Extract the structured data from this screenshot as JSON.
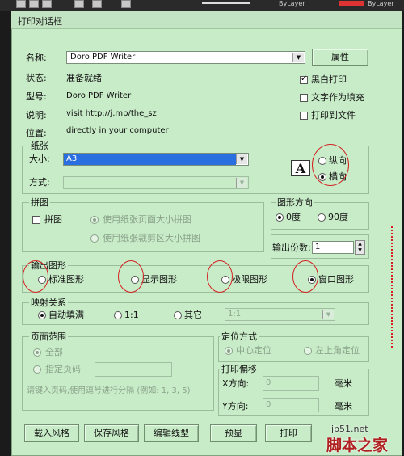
{
  "toolbar": {
    "bylayer1": "ByLayer",
    "bylayer2": "ByLayer"
  },
  "dialog": {
    "title": "打印对话框",
    "printer": {
      "name_label": "名称:",
      "name_value": "Doro PDF Writer",
      "properties_button": "属性",
      "status_label": "状态:",
      "status_value": "准备就绪",
      "type_label": "型号:",
      "type_value": "Doro PDF Writer",
      "desc_label": "说明:",
      "desc_value": "visit http://j.mp/the_sz",
      "location_label": "位置:",
      "location_value": "directly in your computer",
      "bw_print": "黑白打印",
      "text_fill": "文字作为填充",
      "print_to_file": "打印到文件"
    },
    "paper": {
      "group": "纸张",
      "size_label": "大小:",
      "size_value": "A3",
      "method_label": "方式:",
      "portrait": "纵向",
      "landscape": "横向",
      "orientation_icon": "A"
    },
    "tile": {
      "group": "拼图",
      "tile_check": "拼图",
      "opt1": "使用纸张页面大小拼图",
      "opt2": "使用纸张裁剪区大小拼图"
    },
    "direction": {
      "group": "图形方向",
      "deg0": "0度",
      "deg90": "90度"
    },
    "copies": {
      "label": "输出份数:",
      "value": "1"
    },
    "output": {
      "group": "输出图形",
      "standard": "标准图形",
      "display": "显示图形",
      "extent": "极限图形",
      "window": "窗口图形"
    },
    "mapping": {
      "group": "映射关系",
      "auto_fill": "自动填满",
      "one_to_one": "1:1",
      "other": "其它",
      "ratio_value": "1:1"
    },
    "pagerange": {
      "group": "页面范围",
      "all": "全部",
      "specify": "指定页码",
      "hint": "请键入页码,使用逗号进行分隔 (例如: 1, 3, 5)"
    },
    "position": {
      "group": "定位方式",
      "center": "中心定位",
      "top_left": "左上角定位"
    },
    "offset": {
      "group": "打印偏移",
      "x_label": "X方向:",
      "x_value": "0",
      "y_label": "Y方向:",
      "y_value": "0",
      "unit_x": "毫米",
      "unit_y": "毫米"
    },
    "buttons": {
      "load_style": "载入风格",
      "save_style": "保存风格",
      "edit_linetype": "编辑线型",
      "preview": "预显",
      "print": "打印"
    }
  },
  "watermark": {
    "site": "jb51.net",
    "brand": "脚本之家"
  }
}
